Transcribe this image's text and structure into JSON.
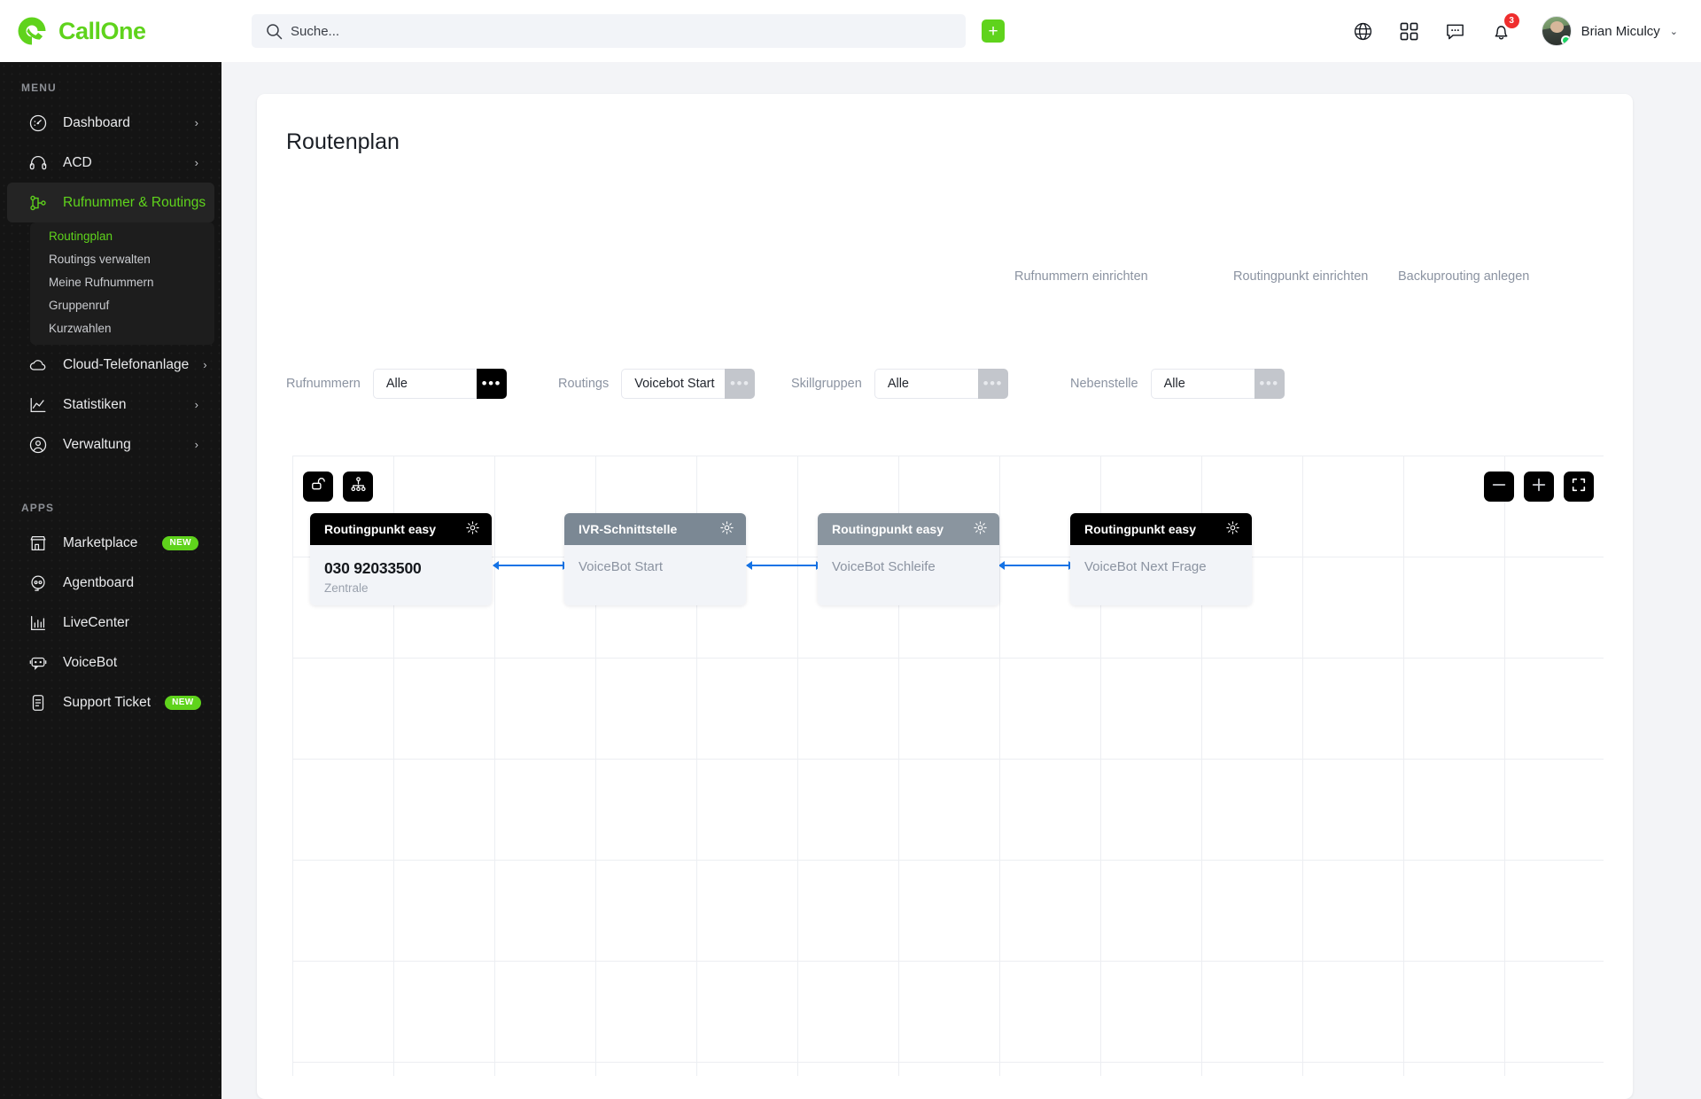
{
  "brand": {
    "name": "CallOne",
    "icon": "callone-logo-icon"
  },
  "search": {
    "placeholder": "Suche...",
    "value": "",
    "icon": "search-icon"
  },
  "topbar": {
    "add_label": "+",
    "icons": [
      "globe-icon",
      "grid-apps-icon",
      "chat-icon",
      "bell-icon"
    ],
    "notification_count": "3",
    "user_name": "Brian Miculcy",
    "caret": "⌄"
  },
  "sidebar": {
    "menu_label": "MENU",
    "apps_label": "APPS",
    "menu_items": [
      {
        "label": "Dashboard",
        "icon": "dashboard-gauge-icon",
        "chev": "›",
        "active": false
      },
      {
        "label": "ACD",
        "icon": "headset-icon",
        "chev": "›",
        "active": false
      },
      {
        "label": "Rufnummer & Routings",
        "icon": "routing-node-icon",
        "chev": "⌄",
        "active": true
      },
      {
        "label": "Cloud-Telefonanlage",
        "icon": "cloud-icon",
        "chev": "›",
        "active": false
      },
      {
        "label": "Statistiken",
        "icon": "chart-line-icon",
        "chev": "›",
        "active": false
      },
      {
        "label": "Verwaltung",
        "icon": "user-circle-icon",
        "chev": "›",
        "active": false
      }
    ],
    "sub_items": [
      {
        "label": "Routingplan",
        "active": true
      },
      {
        "label": "Routings verwalten",
        "active": false
      },
      {
        "label": "Meine Rufnummern",
        "active": false
      },
      {
        "label": "Gruppenruf",
        "active": false
      },
      {
        "label": "Kurzwahlen",
        "active": false
      }
    ],
    "app_items": [
      {
        "label": "Marketplace",
        "icon": "store-icon",
        "badge": "NEW"
      },
      {
        "label": "Agentboard",
        "icon": "agent-headset-icon",
        "badge": ""
      },
      {
        "label": "LiveCenter",
        "icon": "bar-chart-icon",
        "badge": ""
      },
      {
        "label": "VoiceBot",
        "icon": "robot-icon",
        "badge": ""
      },
      {
        "label": "Support Ticket",
        "icon": "ticket-doc-icon",
        "badge": "NEW"
      }
    ]
  },
  "main": {
    "title": "Routenplan",
    "quick_links": [
      {
        "label": "Rufnummern einrichten"
      },
      {
        "label": "Routingpunkt einrichten"
      },
      {
        "label": "Backuprouting anlegen"
      }
    ],
    "filters": [
      {
        "label": "Rufnummern",
        "value": "Alle",
        "dots": "•••",
        "style": "dark"
      },
      {
        "label": "Routings",
        "value": "Voicebot Start",
        "dots": "•••",
        "style": "grey"
      },
      {
        "label": "Skillgruppen",
        "value": "Alle",
        "dots": "•••",
        "style": "grey"
      },
      {
        "label": "Nebenstelle",
        "value": "Alle",
        "dots": "•••",
        "style": "grey"
      }
    ]
  },
  "canvas": {
    "tools": [
      {
        "name": "lock-open-icon"
      },
      {
        "name": "hierarchy-icon"
      }
    ],
    "zoom_controls": [
      {
        "name": "zoom-out-icon"
      },
      {
        "name": "zoom-in-icon"
      },
      {
        "name": "fit-screen-icon"
      }
    ],
    "nodes": [
      {
        "header": "Routingpunkt easy",
        "header_style": "black",
        "title": "030 92033500",
        "sub": "Zentrale",
        "plain": "",
        "gear": "gear-icon"
      },
      {
        "header": "IVR-Schnittstelle",
        "header_style": "grey",
        "title": "",
        "sub": "",
        "plain": "VoiceBot Start",
        "gear": "gear-icon"
      },
      {
        "header": "Routingpunkt easy",
        "header_style": "grey-light",
        "title": "",
        "sub": "",
        "plain": "VoiceBot Schleife",
        "gear": "gear-icon"
      },
      {
        "header": "Routingpunkt easy",
        "header_style": "black",
        "title": "",
        "sub": "",
        "plain": "VoiceBot Next Frage",
        "gear": "gear-icon"
      }
    ]
  }
}
